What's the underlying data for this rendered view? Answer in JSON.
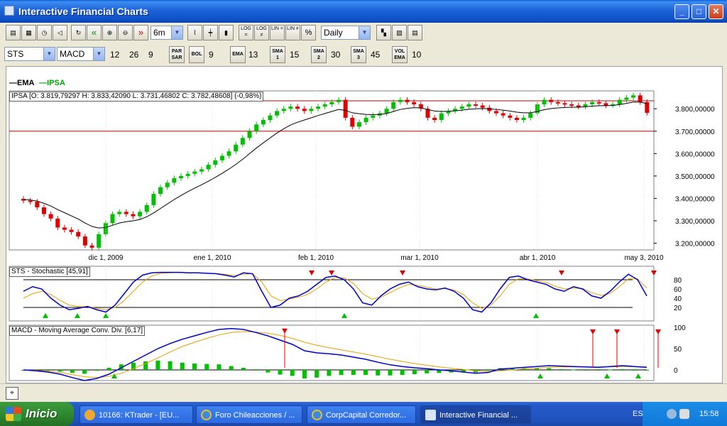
{
  "window": {
    "title": "Interactive Financial Charts"
  },
  "toolbar1": {
    "period": "6m",
    "interval": "Daily",
    "buttons": [
      {
        "name": "print-icon",
        "label": ""
      },
      {
        "name": "fax-icon",
        "label": ""
      },
      {
        "name": "alarm-icon",
        "label": ""
      },
      {
        "name": "sound-icon",
        "label": ""
      },
      {
        "name": "refresh-icon",
        "label": ""
      },
      {
        "name": "rewind-icon",
        "label": "«"
      },
      {
        "name": "zoom-in-icon",
        "label": ""
      },
      {
        "name": "zoom-out-icon",
        "label": ""
      },
      {
        "name": "forward-icon",
        "label": "»"
      }
    ],
    "scale_buttons": [
      "LOG =",
      "LOG ≠",
      "LIN =",
      "LIN ≠",
      "%"
    ]
  },
  "toolbar2": {
    "symbol": "STS",
    "indicator": "MACD",
    "macd_params": [
      "12",
      "26",
      "9"
    ],
    "par_sar_label": "PAR SAR",
    "bol_label": "BOL",
    "bol_value": "9",
    "ema_label": "EMA",
    "ema_value": "13",
    "sma1_label": "SMA 1",
    "sma1_value": "15",
    "sma2_label": "SMA 2",
    "sma2_value": "30",
    "sma3_label": "SMA 3",
    "sma3_value": "45",
    "volema_label": "VOL EMA",
    "volema_value": "10"
  },
  "legend": {
    "ema": "EMA",
    "ipsa": "IPSA"
  },
  "main_panel": {
    "title": "IPSA [O: 3.819,79297  H: 3.833,42090  L: 3.731,46802  C: 3.782,48608] (-0,98%)",
    "y_ticks": [
      "3.800,00000",
      "3.700,00000",
      "3.600,00000",
      "3.500,00000",
      "3.400,00000",
      "3.300,00000",
      "3.200,00000"
    ],
    "x_ticks": [
      "dic 1, 2009",
      "ene 1, 2010",
      "feb 1, 2010",
      "mar 1, 2010",
      "abr 1, 2010",
      "may 3, 2010"
    ]
  },
  "stoch_panel": {
    "title": "STS - Stochastic [45,91]",
    "y_ticks": [
      "80",
      "60",
      "40",
      "20"
    ]
  },
  "macd_panel": {
    "title": "MACD - Moving Average Conv. Div. [6,17]",
    "y_ticks": [
      "100",
      "50",
      "0"
    ]
  },
  "colors": {
    "up": "#00c000",
    "down": "#e00000",
    "ema": "#000000",
    "signal": "#e8a000",
    "line": "#0000c8"
  },
  "taskbar": {
    "start": "Inicio",
    "tasks": [
      {
        "label": "10166: KTrader - [EU..."
      },
      {
        "label": "Foro Chileacciones / ..."
      },
      {
        "label": "CorpCapital Corredor..."
      },
      {
        "label": "Interactive Financial ..."
      }
    ],
    "lang": "ES",
    "time": "15:58"
  },
  "chart_data": [
    {
      "type": "candlestick",
      "title": "IPSA [O: 3.819,79297  H: 3.833,42090  L: 3.731,46802  C: 3.782,48608] (-0,98%)",
      "ylim": [
        3170,
        3880
      ],
      "x": [
        "dic 1, 2009",
        "ene 1, 2010",
        "feb 1, 2010",
        "mar 1, 2010",
        "abr 1, 2010",
        "may 3, 2010"
      ],
      "close": [
        3390,
        3385,
        3360,
        3330,
        3310,
        3270,
        3260,
        3250,
        3230,
        3190,
        3180,
        3240,
        3290,
        3330,
        3340,
        3330,
        3320,
        3340,
        3370,
        3420,
        3450,
        3470,
        3490,
        3500,
        3510,
        3520,
        3530,
        3550,
        3570,
        3590,
        3610,
        3640,
        3670,
        3700,
        3730,
        3750,
        3770,
        3790,
        3800,
        3810,
        3800,
        3790,
        3800,
        3810,
        3820,
        3830,
        3840,
        3760,
        3720,
        3740,
        3760,
        3770,
        3780,
        3800,
        3830,
        3840,
        3830,
        3820,
        3800,
        3760,
        3750,
        3780,
        3790,
        3800,
        3810,
        3820,
        3815,
        3805,
        3790,
        3780,
        3770,
        3760,
        3750,
        3760,
        3780,
        3820,
        3840,
        3830,
        3825,
        3820,
        3815,
        3810,
        3820,
        3830,
        3825,
        3815,
        3820,
        3840,
        3850,
        3860,
        3830,
        3782
      ],
      "ema": [
        3395,
        3393,
        3388,
        3378,
        3366,
        3350,
        3336,
        3322,
        3308,
        3290,
        3275,
        3268,
        3270,
        3280,
        3290,
        3296,
        3300,
        3306,
        3318,
        3335,
        3355,
        3375,
        3395,
        3413,
        3430,
        3446,
        3461,
        3477,
        3494,
        3512,
        3531,
        3552,
        3575,
        3600,
        3625,
        3648,
        3670,
        3692,
        3711,
        3728,
        3740,
        3750,
        3760,
        3770,
        3779,
        3788,
        3797,
        3793,
        3782,
        3778,
        3775,
        3774,
        3775,
        3779,
        3788,
        3797,
        3802,
        3805,
        3804,
        3797,
        3790,
        3788,
        3789,
        3791,
        3794,
        3798,
        3800,
        3801,
        3800,
        3797,
        3794,
        3790,
        3785,
        3782,
        3782,
        3788,
        3796,
        3801,
        3804,
        3806,
        3807,
        3807,
        3809,
        3812,
        3814,
        3814,
        3815,
        3819,
        3824,
        3830,
        3830,
        3823
      ]
    },
    {
      "type": "line",
      "title": "STS - Stochastic [45,91]",
      "ylim": [
        0,
        100
      ],
      "series": [
        {
          "values": [
            55,
            65,
            60,
            40,
            25,
            15,
            18,
            22,
            15,
            10,
            25,
            50,
            75,
            90,
            95,
            96,
            96,
            96,
            95,
            95,
            94,
            93,
            90,
            86,
            95,
            93,
            55,
            20,
            25,
            40,
            45,
            55,
            70,
            85,
            88,
            80,
            60,
            30,
            25,
            45,
            60,
            70,
            75,
            65,
            60,
            58,
            62,
            55,
            40,
            15,
            10,
            30,
            60,
            85,
            88,
            80,
            75,
            70,
            60,
            55,
            65,
            60,
            45,
            40,
            55,
            75,
            92,
            80,
            45
          ]
        },
        {
          "values": [
            40,
            50,
            55,
            48,
            35,
            25,
            22,
            22,
            18,
            15,
            20,
            35,
            55,
            75,
            88,
            94,
            95,
            96,
            95,
            95,
            94,
            93,
            92,
            89,
            92,
            93,
            75,
            45,
            35,
            38,
            42,
            48,
            60,
            75,
            85,
            84,
            72,
            50,
            38,
            42,
            52,
            62,
            70,
            68,
            64,
            60,
            61,
            58,
            48,
            30,
            18,
            25,
            45,
            70,
            82,
            82,
            78,
            74,
            66,
            60,
            62,
            61,
            52,
            46,
            50,
            65,
            82,
            82,
            62
          ]
        }
      ]
    },
    {
      "type": "bar",
      "title": "MACD - Moving Average Conv. Div. [6,17]",
      "ylim": [
        -25,
        105
      ],
      "series": [
        {
          "values": [
            0,
            -2,
            -5,
            -10,
            -18,
            -25,
            -20,
            -10,
            5,
            20,
            35,
            50,
            62,
            72,
            80,
            88,
            95,
            97,
            95,
            88,
            80,
            70,
            60,
            45,
            40,
            38,
            35,
            30,
            25,
            18,
            12,
            8,
            5,
            3,
            0,
            -2,
            -5,
            -8,
            -6,
            2,
            4,
            6,
            8,
            10,
            9,
            8,
            7,
            6,
            8,
            10,
            8,
            6
          ]
        },
        {
          "values": [
            0,
            -1,
            -3,
            -6,
            -11,
            -16,
            -18,
            -15,
            -8,
            3,
            15,
            28,
            42,
            55,
            65,
            74,
            82,
            88,
            90,
            89,
            86,
            81,
            74,
            65,
            58,
            52,
            47,
            42,
            37,
            31,
            25,
            20,
            15,
            11,
            7,
            4,
            1,
            -2,
            -4,
            -2,
            0,
            2,
            4,
            6,
            7,
            7,
            7,
            7,
            7,
            8,
            8,
            7
          ]
        },
        {
          "values": [
            0,
            -1,
            -2,
            -4,
            -7,
            -9,
            -2,
            5,
            13,
            17,
            20,
            22,
            20,
            17,
            15,
            14,
            13,
            9,
            5,
            -1,
            -6,
            -11,
            -14,
            -20,
            -18,
            -14,
            -12,
            -12,
            -12,
            -13,
            -13,
            -12,
            -10,
            -8,
            -7,
            -6,
            -6,
            -6,
            -2,
            4,
            4,
            4,
            4,
            4,
            2,
            1,
            0,
            -1,
            1,
            2,
            0,
            -1
          ]
        }
      ]
    }
  ]
}
